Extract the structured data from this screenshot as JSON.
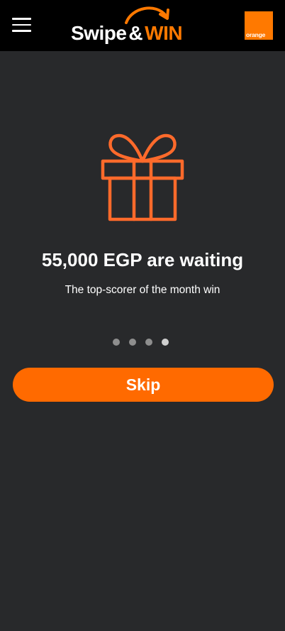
{
  "header": {
    "menu_icon": "hamburger-menu-icon",
    "logo": {
      "part1": "Swipe",
      "ampersand": "&",
      "part2": "WIN",
      "accent_color": "#ff7900"
    },
    "brand_label": "orange",
    "brand_color": "#ff7900"
  },
  "onboarding": {
    "icon": "gift-icon",
    "icon_color": "#ff6a2b",
    "headline": "55,000 EGP are waiting",
    "subline": "The top-scorer of the month win",
    "pages_total": 4,
    "current_page": 4
  },
  "skip_button": {
    "label": "Skip",
    "color": "#ff6a00"
  }
}
